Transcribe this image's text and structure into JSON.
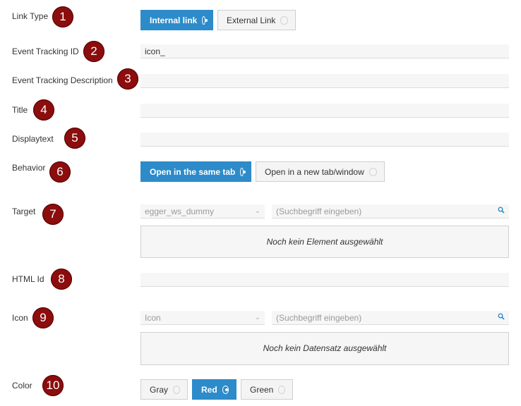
{
  "link_type": {
    "label": "Link Type",
    "badge": "1",
    "options": [
      {
        "label": "Internal link",
        "selected": true
      },
      {
        "label": "External Link",
        "selected": false
      }
    ]
  },
  "event_tracking_id": {
    "label": "Event Tracking ID",
    "badge": "2",
    "value": "icon_"
  },
  "event_tracking_description": {
    "label": "Event Tracking Description",
    "badge": "3",
    "value": ""
  },
  "title": {
    "label": "Title",
    "badge": "4",
    "value": ""
  },
  "displaytext": {
    "label": "Displaytext",
    "badge": "5",
    "value": ""
  },
  "behavior": {
    "label": "Behavior",
    "badge": "6",
    "options": [
      {
        "label": "Open in the same tab",
        "selected": true
      },
      {
        "label": "Open in a new tab/window",
        "selected": false
      }
    ]
  },
  "target": {
    "label": "Target",
    "badge": "7",
    "select_value": "egger_ws_dummy",
    "search_placeholder": "(Suchbegriff eingeben)",
    "empty_text": "Noch kein Element ausgewählt"
  },
  "html_id": {
    "label": "HTML Id",
    "badge": "8",
    "value": ""
  },
  "icon": {
    "label": "Icon",
    "badge": "9",
    "select_value": "Icon",
    "search_placeholder": "(Suchbegriff eingeben)",
    "empty_text": "Noch kein Datensatz ausgewählt"
  },
  "color": {
    "label": "Color",
    "badge": "10",
    "options": [
      {
        "label": "Gray",
        "selected": false
      },
      {
        "label": "Red",
        "selected": true
      },
      {
        "label": "Green",
        "selected": false
      }
    ]
  },
  "colors": {
    "accent": "#2d8bc9",
    "badge": "#8b0d0d"
  }
}
